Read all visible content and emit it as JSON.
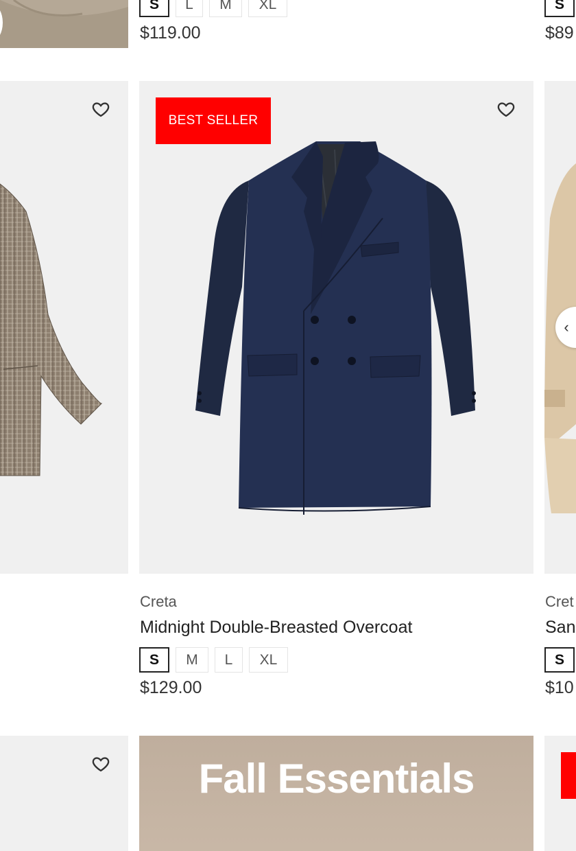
{
  "row_top": {
    "left": {
      "cut_price_visible": false
    },
    "middle": {
      "sizes": [
        {
          "label": "S",
          "selected": true
        },
        {
          "label": "L",
          "selected": false
        },
        {
          "label": "M",
          "selected": false
        },
        {
          "label": "XL",
          "selected": false
        }
      ],
      "price": "$119.00"
    },
    "right": {
      "size_first": "S",
      "price_partial": "$89"
    }
  },
  "row_middle": {
    "left": {
      "icon": "heart-outline-icon"
    },
    "middle": {
      "badge": "BEST SELLER",
      "icon": "heart-outline-icon",
      "brand": "Creta",
      "title": "Midnight Double-Breasted Overcoat",
      "sizes": [
        {
          "label": "S",
          "selected": true
        },
        {
          "label": "M",
          "selected": false
        },
        {
          "label": "L",
          "selected": false
        },
        {
          "label": "XL",
          "selected": false
        }
      ],
      "price": "$129.00"
    },
    "right": {
      "brand_partial": "Cret",
      "title_partial": "San",
      "size_first": "S",
      "price_partial": "$10",
      "nav_icon": "chevron-left-icon"
    }
  },
  "row_bottom": {
    "left": {
      "icon": "heart-outline-icon"
    },
    "banner": {
      "title": "Fall Essentials"
    },
    "right": {
      "badge_color": "#ff0000"
    }
  },
  "colors": {
    "badge": "#ff0000",
    "card_bg": "#f0f0f0",
    "text": "#222222"
  }
}
